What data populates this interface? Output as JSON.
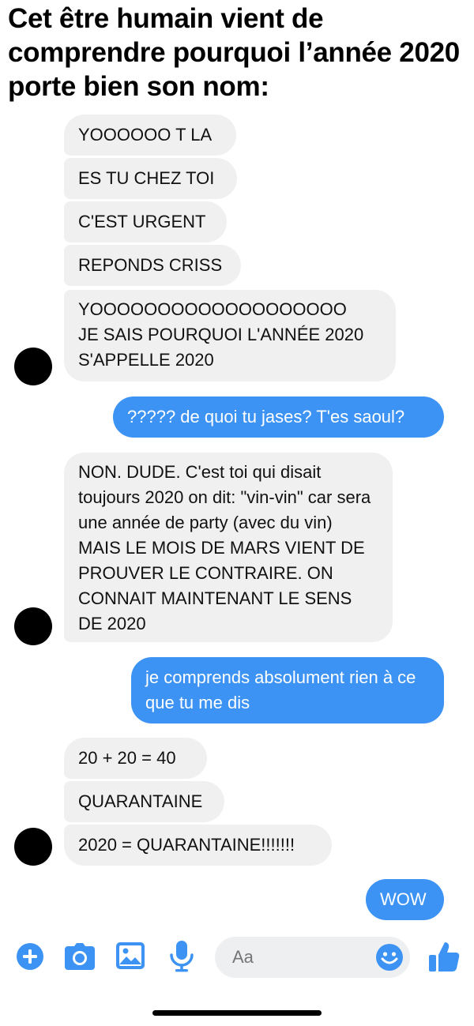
{
  "caption": "Cet être humain vient de comprendre pourquoi l’année 2020 porte bien son nom:",
  "messages": [
    {
      "text": "YOOOOOO T LA"
    },
    {
      "text": "ES TU CHEZ TOI"
    },
    {
      "text": "C'EST URGENT"
    },
    {
      "text": "REPONDS CRISS"
    },
    {
      "line1": "YOOOOOOOOOOOOOOOOOOO",
      "line2": "JE SAIS POURQUOI L'ANNÉE 2020",
      "line3": "S'APPELLE 2020"
    },
    {
      "text": "????? de quoi tu jases? T'es saoul?"
    },
    {
      "text": "NON. DUDE. C'est toi qui disait toujours 2020 on dit: \"vin-vin\" car sera une année de party (avec du vin) MAIS LE MOIS DE MARS VIENT DE PROUVER LE CONTRAIRE. ON CONNAIT MAINTENANT LE SENS DE 2020"
    },
    {
      "text": "je comprends absolument rien à ce que tu me dis"
    },
    {
      "text": "20 + 20 = 40"
    },
    {
      "text": "QUARANTAINE"
    },
    {
      "text": "2020 = QUARANTAINE!!!!!!!"
    },
    {
      "text": "WOW"
    }
  ],
  "composer": {
    "placeholder": "Aa",
    "icons": [
      "plus-icon",
      "camera-icon",
      "image-icon",
      "microphone-icon",
      "emoji-icon",
      "thumbs-up-icon"
    ],
    "accent": "#3c93f4"
  },
  "colors": {
    "outgoing_bubble": "#3c93f4",
    "incoming_bubble": "#f0f0f0"
  }
}
